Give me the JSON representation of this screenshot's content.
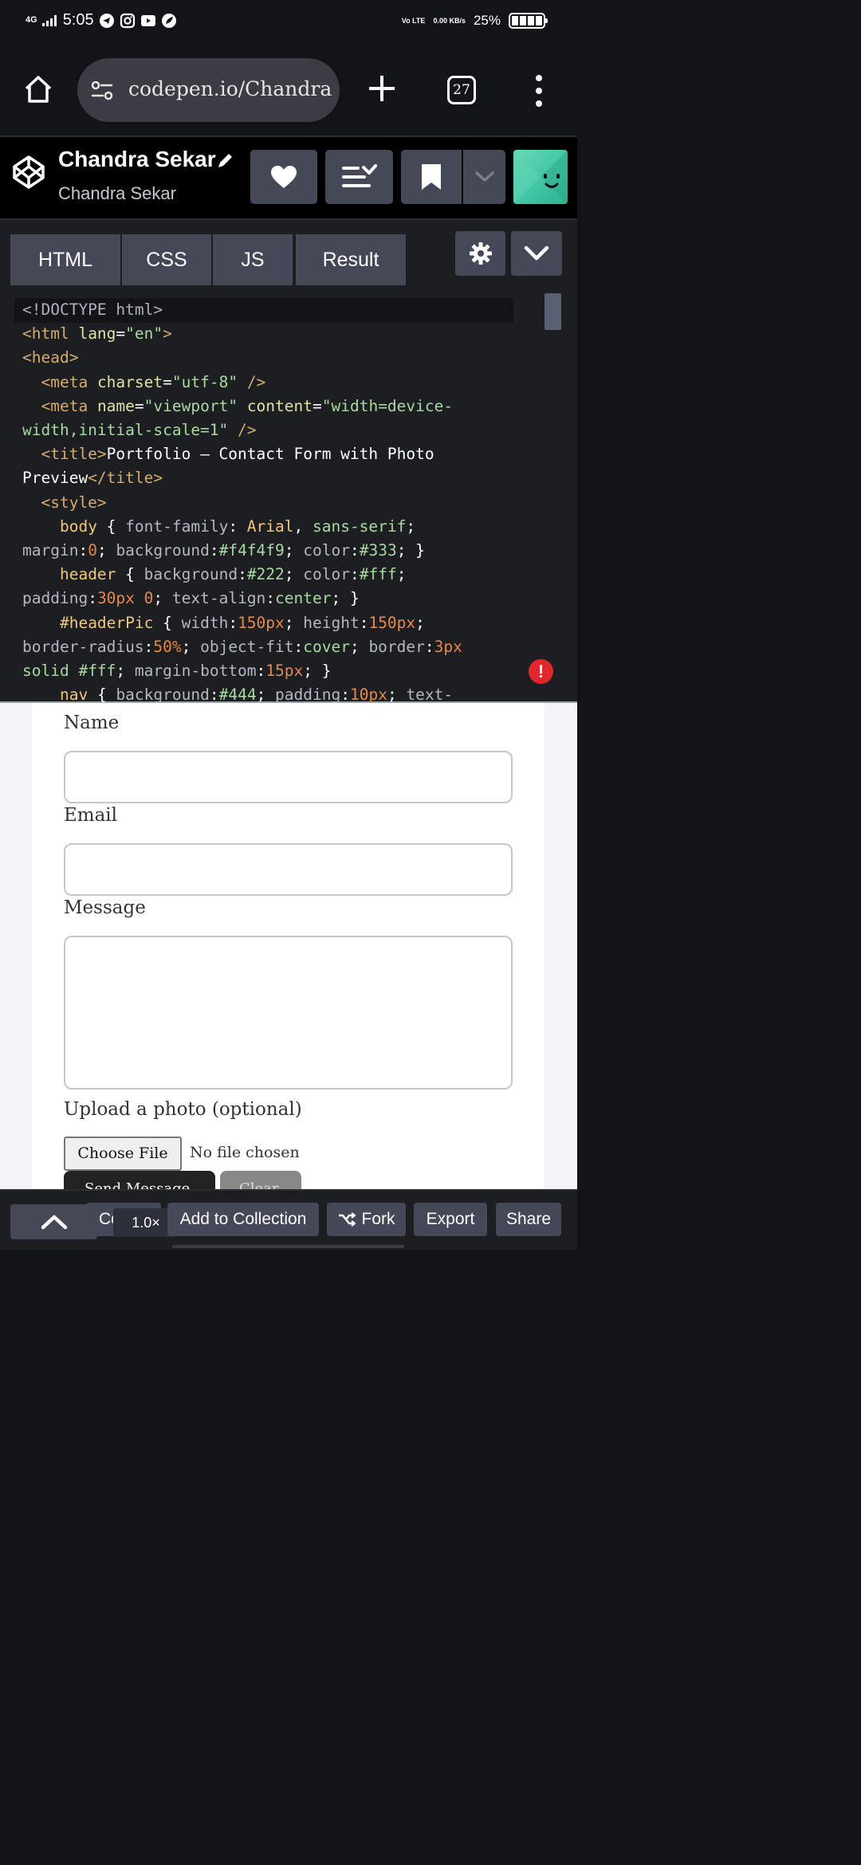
{
  "status_bar": {
    "network": "4G",
    "time": "5:05",
    "volte": "Vo LTE",
    "speed": "0.00 KB/s",
    "battery": "25%"
  },
  "browser": {
    "url": "codepen.io/Chandra",
    "tab_count": "27"
  },
  "pen": {
    "title": "Chandra Sekar",
    "author": "Chandra Sekar"
  },
  "editor": {
    "tabs": [
      "HTML",
      "CSS",
      "JS",
      "Result"
    ],
    "error_symbol": "!"
  },
  "result": {
    "labels": {
      "name": "Name",
      "email": "Email",
      "message": "Message",
      "upload": "Upload a photo (optional)"
    },
    "choose_file": "Choose File",
    "no_file": "No file chosen",
    "send_button": "Send Message",
    "clear_button": "Clear"
  },
  "bottom_bar": {
    "console": "Console",
    "zoom": "1.0×",
    "add_to_collection": "Add to Collection",
    "fork": "Fork",
    "export": "Export",
    "share": "Share"
  },
  "colors": {
    "editor_bg": "#1d1e22",
    "button_bg": "#444857",
    "error": "#e0262e",
    "result_bg": "#f4f4f9"
  }
}
